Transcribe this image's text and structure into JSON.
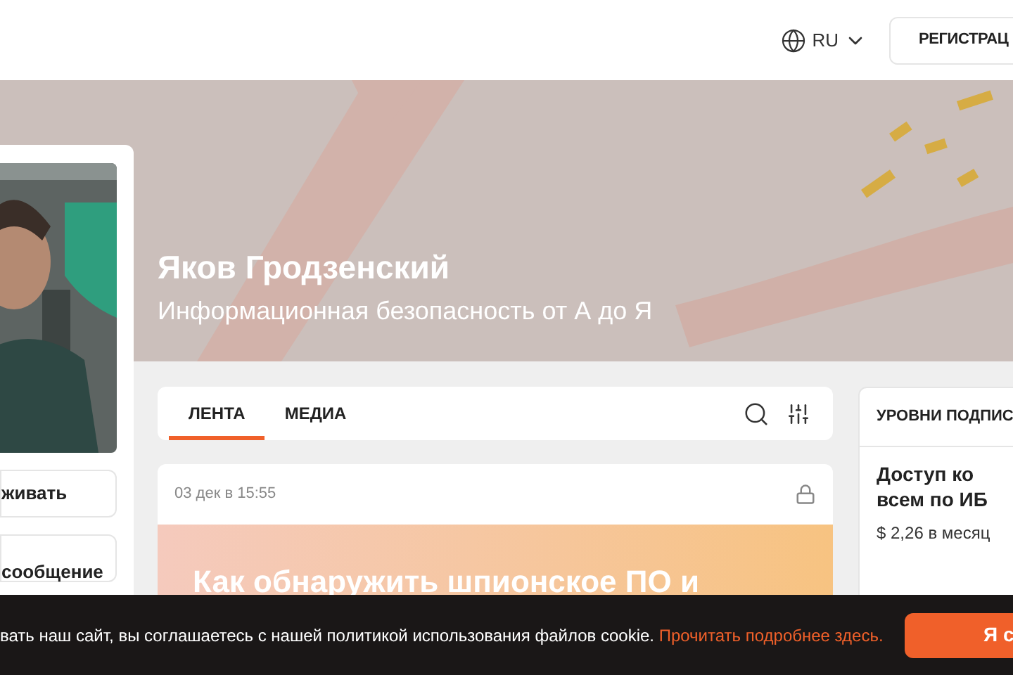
{
  "header": {
    "language": "RU",
    "register_button": "РЕГИСТРАЦ"
  },
  "banner": {
    "name": "Яков Гродзенский",
    "tagline": "Информационная безопасность от А до Я"
  },
  "profile": {
    "buttons": [
      "живать",
      "сообщение"
    ]
  },
  "tabs": [
    {
      "label": "ЛЕНТА",
      "selected": true
    },
    {
      "label": "МЕДИА",
      "selected": false
    }
  ],
  "post": {
    "date": "03 дек в 15:55",
    "locked": true,
    "title": "Как обнаружить шпионское ПО и"
  },
  "subscription_levels": {
    "title": "УРОВНИ ПОДПИС",
    "tiers": [
      {
        "name": "Доступ ко всем по ИБ",
        "price": "$ 2,26 в месяц"
      }
    ]
  },
  "cookie_bar": {
    "text": "вать наш сайт, вы соглашаетесь с нашей политикой использования файлов cookie.",
    "link": "Прочитать подробнее здесь.",
    "button": "Я с"
  }
}
